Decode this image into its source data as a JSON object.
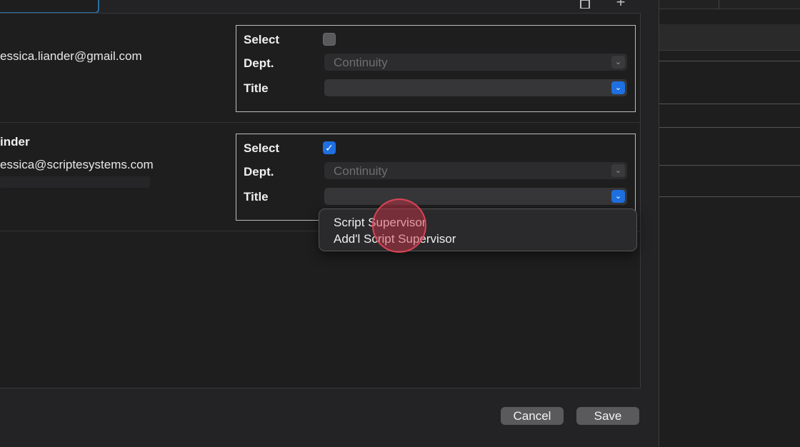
{
  "rows": [
    {
      "name": "",
      "email": "essica.liander@gmail.com",
      "select_label": "Select",
      "select_checked": false,
      "dept_label": "Dept.",
      "dept_value": "Continuity",
      "title_label": "Title",
      "title_value": ""
    },
    {
      "name": "inder",
      "email": "essica@scriptesystems.com",
      "select_label": "Select",
      "select_checked": true,
      "dept_label": "Dept.",
      "dept_value": "Continuity",
      "title_label": "Title",
      "title_value": ""
    }
  ],
  "dropdown": {
    "options": [
      "Script Supervisor",
      "Add'l Script Supervisor"
    ]
  },
  "footer": {
    "cancel_label": "Cancel",
    "save_label": "Save"
  },
  "icons": {
    "checkmark": "✓",
    "chevron": "⌄",
    "plus": "+"
  }
}
